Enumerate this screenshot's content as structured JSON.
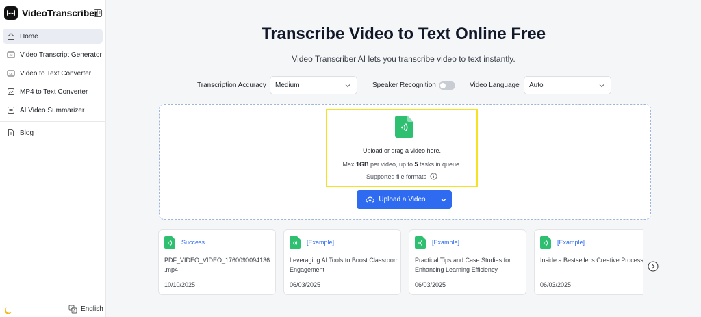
{
  "sidebar": {
    "brand": "VideoTranscriber",
    "items": [
      {
        "label": "Home"
      },
      {
        "label": "Video Transcript Generator"
      },
      {
        "label": "Video to Text Converter"
      },
      {
        "label": "MP4 to Text Converter"
      },
      {
        "label": "AI Video Summarizer"
      }
    ],
    "blog": "Blog",
    "language": "English"
  },
  "main": {
    "title": "Transcribe Video to Text Online Free",
    "subtitle": "Video Transcriber AI lets you transcribe video to text instantly.",
    "options": {
      "accuracy_label": "Transcription Accuracy",
      "accuracy_value": "Medium",
      "speaker_label": "Speaker Recognition",
      "speaker_enabled": false,
      "language_label": "Video Language",
      "language_value": "Auto"
    },
    "upload": {
      "drop_text": "Upload or drag a video here.",
      "limit_prefix": "Max ",
      "limit_size": "1GB",
      "limit_mid": " per video, up to ",
      "limit_tasks": "5",
      "limit_suffix": " tasks in queue.",
      "formats": "Supported file formats",
      "button": "Upload a Video"
    },
    "cards": [
      {
        "status": "Success",
        "title": "PDF_VIDEO_VIDEO_1760090094136 .mp4",
        "date": "10/10/2025"
      },
      {
        "status": "[Example]",
        "title": "Leveraging AI Tools to Boost Classroom Engagement",
        "date": "06/03/2025"
      },
      {
        "status": "[Example]",
        "title": "Practical Tips and Case Studies for Enhancing Learning Efficiency",
        "date": "06/03/2025"
      },
      {
        "status": "[Example]",
        "title": "Inside a Bestseller's Creative Process",
        "date": "06/03/2025"
      }
    ]
  },
  "colors": {
    "accent": "#2e6bf0",
    "file_green": "#2fbf71",
    "highlight": "#f7e125"
  }
}
